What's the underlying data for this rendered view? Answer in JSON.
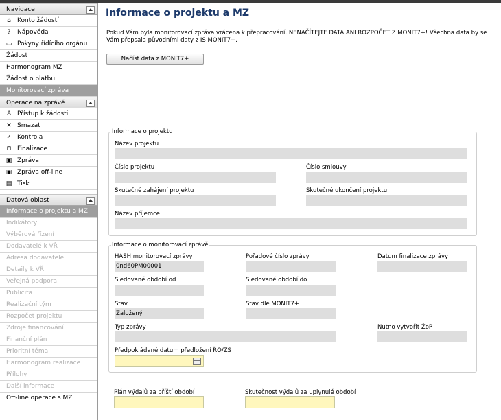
{
  "sidebar": {
    "navigace": {
      "title": "Navigace",
      "items": [
        {
          "label": "Konto žádostí",
          "icon": "home-icon",
          "glyph": "⌂"
        },
        {
          "label": "Nápověda",
          "icon": "help-icon",
          "glyph": "?"
        },
        {
          "label": "Pokyny řídícího orgánu",
          "icon": "book-icon",
          "glyph": "▭"
        }
      ],
      "plain": [
        "Žádost",
        "Harmonogram MZ",
        "Žádost o platbu"
      ],
      "active": "Monitorovací zpráva"
    },
    "operace": {
      "title": "Operace na zprávě",
      "items": [
        {
          "label": "Přístup k žádosti",
          "icon": "user-icon",
          "glyph": "♙"
        },
        {
          "label": "Smazat",
          "icon": "delete-icon",
          "glyph": "✕"
        },
        {
          "label": "Kontrola",
          "icon": "check-icon",
          "glyph": "✓"
        },
        {
          "label": "Finalizace",
          "icon": "lock-icon",
          "glyph": "⊓"
        },
        {
          "label": "Zpráva",
          "icon": "report-icon",
          "glyph": "▣"
        },
        {
          "label": "Zpráva off-line",
          "icon": "offline-report-icon",
          "glyph": "▣"
        },
        {
          "label": "Tisk",
          "icon": "print-icon",
          "glyph": "▤"
        }
      ]
    },
    "datova": {
      "title": "Datová oblast",
      "active": "Informace o projektu a MZ",
      "disabled": [
        "Indikátory",
        "Výběrová řízení",
        "Dodavatelé k VŘ",
        "Adresa dodavatele",
        "Detaily k VŘ",
        "Veřejná podpora",
        "Publicita",
        "Realizační tým",
        "Rozpočet projektu",
        "Zdroje financování",
        "Finanční plán",
        "Prioritní téma",
        "Harmonogram realizace",
        "Přílohy",
        "Další informace"
      ],
      "last": "Off-line operace s MZ"
    }
  },
  "main": {
    "title": "Informace o projektu a MZ",
    "notice": "Pokud Vám byla monitorovací zpráva vrácena k přepracování, NENAČÍTEJTE DATA ANI ROZPOČET Z MONIT7+! Všechna data by se Vám přepsala původními daty z IS MONIT7+.",
    "load_button": "Načíst data z MONIT7+",
    "project": {
      "legend": "Informace o projektu",
      "nazev_label": "Název projektu",
      "nazev_value": "",
      "cislo_label": "Číslo projektu",
      "cislo_value": "",
      "smlouva_label": "Číslo smlouvy",
      "smlouva_value": "",
      "zahajeni_label": "Skutečné zahájení projektu",
      "zahajeni_value": "",
      "ukonceni_label": "Skutečné ukončení projektu",
      "ukonceni_value": "",
      "prijemce_label": "Název příjemce",
      "prijemce_value": ""
    },
    "report": {
      "legend": "Informace o monitorovací zprávě",
      "hash_label": "HASH monitorovací zprávy",
      "hash_value": "0nd60PM00001",
      "poradove_label": "Pořadové číslo zprávy",
      "poradove_value": "",
      "finalizace_label": "Datum finalizace zprávy",
      "finalizace_value": "",
      "od_label": "Sledované období od",
      "od_value": "",
      "do_label": "Sledované období do",
      "do_value": "",
      "stav_label": "Stav",
      "stav_value": "Založený",
      "monit_label": "Stav dle MONIT7+",
      "monit_value": "",
      "typ_label": "Typ zprávy",
      "typ_value": "",
      "zop_label": "Nutno vytvořit ŽoP",
      "zop_value": "",
      "predlozeni_label": "Předpokládané datum předložení ŘO/ZS",
      "predlozeni_value": ""
    },
    "plan_label": "Plán výdajů za příští období",
    "plan_value": "",
    "skutecnost_label": "Skutečnost výdajů za uplynulé období",
    "skutecnost_value": ""
  }
}
